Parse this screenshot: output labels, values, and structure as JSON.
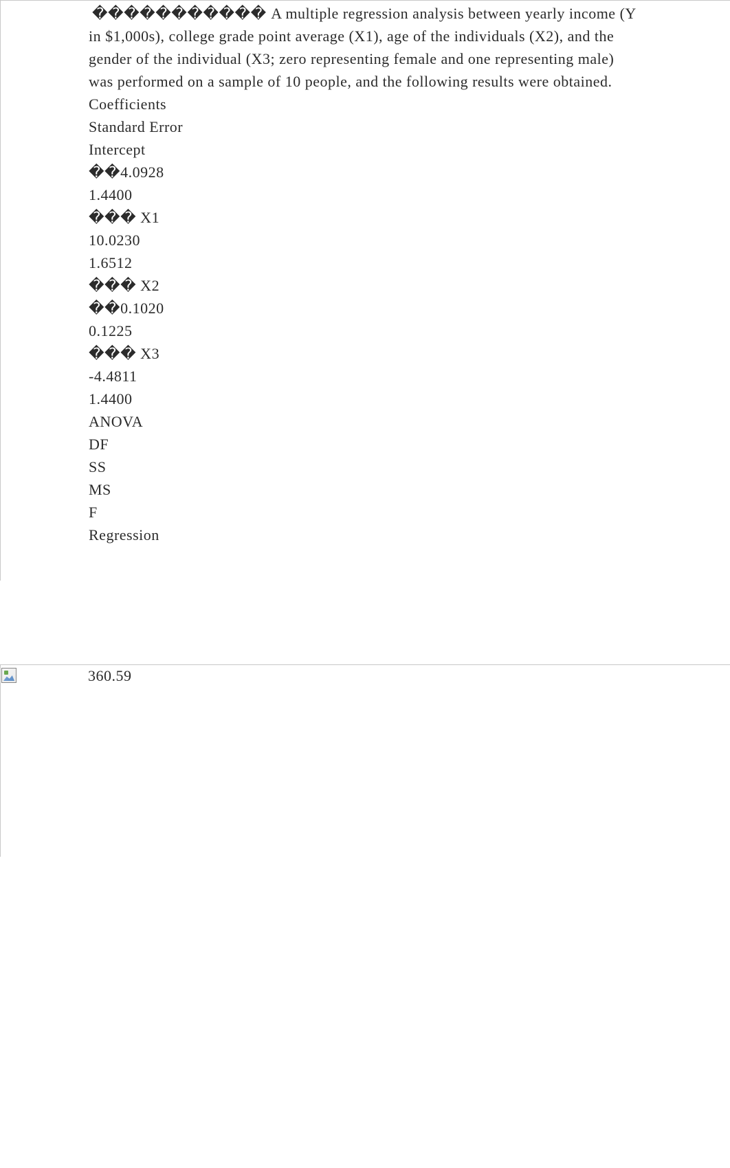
{
  "intro_prefix": "����������� ",
  "intro_text": "A multiple regression analysis between yearly income (Y in $1,000s), college grade point average (X1), age of the individuals (X2), and the gender of the individual (X3; zero representing female and one representing male) was performed on a sample of 10 people, and the following results were obtained.",
  "lines": [
    "Coefficients",
    "Standard Error",
    "Intercept",
    "��4.0928",
    "1.4400",
    "��� X1",
    "10.0230",
    "1.6512",
    "��� X2",
    "��0.1020",
    "0.1225",
    "��� X3",
    "-4.4811",
    "1.4400",
    "ANOVA",
    "DF",
    "SS",
    "MS",
    "F",
    "Regression"
  ],
  "second_value": "360.59",
  "coefficients_table": {
    "headers": [
      "",
      "Coefficients",
      "Standard Error"
    ],
    "rows": [
      {
        "name": "Intercept",
        "coefficient": "4.0928",
        "std_error": "1.4400"
      },
      {
        "name": "X1",
        "coefficient": "10.0230",
        "std_error": "1.6512"
      },
      {
        "name": "X2",
        "coefficient": "0.1020",
        "std_error": "0.1225"
      },
      {
        "name": "X3",
        "coefficient": "-4.4811",
        "std_error": "1.4400"
      }
    ]
  },
  "anova_table": {
    "headers": [
      "",
      "DF",
      "SS",
      "MS",
      "F"
    ],
    "rows": [
      {
        "name": "Regression",
        "ss": "360.59"
      }
    ]
  }
}
